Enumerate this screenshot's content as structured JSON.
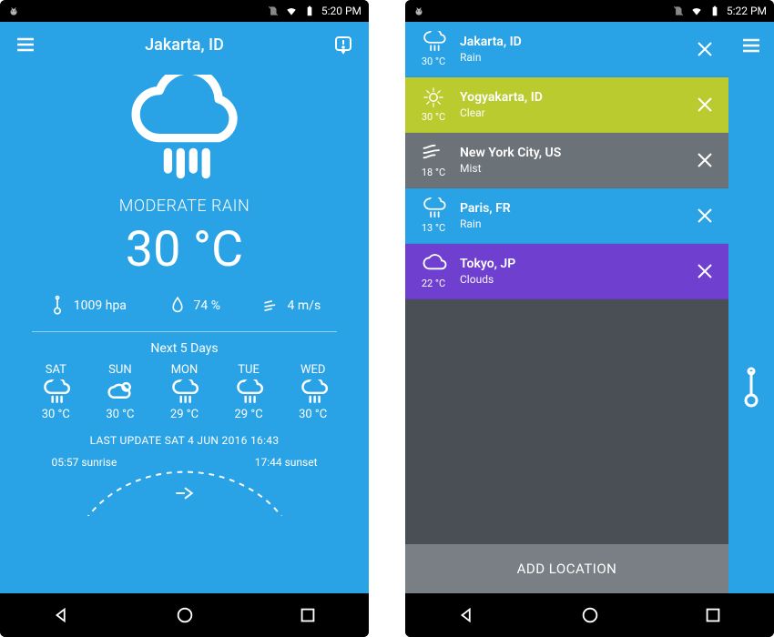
{
  "left": {
    "statusbar": {
      "time": "5:20 PM"
    },
    "header": {
      "title": "Jakarta, ID"
    },
    "main": {
      "condition": "MODERATE RAIN",
      "temp": "30 °C"
    },
    "stats": {
      "pressure": "1009 hpa",
      "humidity": "74 %",
      "wind": "4 m/s"
    },
    "next5_label": "Next 5 Days",
    "forecast": [
      {
        "day": "SAT",
        "temp": "30 °C",
        "icon": "cloud-rain"
      },
      {
        "day": "SUN",
        "temp": "30 °C",
        "icon": "cloud-sun"
      },
      {
        "day": "MON",
        "temp": "29 °C",
        "icon": "cloud-rain"
      },
      {
        "day": "TUE",
        "temp": "29 °C",
        "icon": "cloud-rain"
      },
      {
        "day": "WED",
        "temp": "30 °C",
        "icon": "cloud-rain"
      }
    ],
    "last_update": "LAST UPDATE SAT 4 JUN 2016 16:43",
    "sunrise": "05:57 sunrise",
    "sunset": "17:44 sunset"
  },
  "right": {
    "statusbar": {
      "time": "5:22 PM"
    },
    "locations": [
      {
        "name": "Jakarta, ID",
        "temp": "30 °C",
        "condition": "Rain",
        "icon": "cloud-rain",
        "bg": "#29a3e5"
      },
      {
        "name": "Yogyakarta, ID",
        "temp": "30 °C",
        "condition": "Clear",
        "icon": "sun",
        "bg": "#b9cb2f"
      },
      {
        "name": "New York City, US",
        "temp": "18 °C",
        "condition": "Mist",
        "icon": "mist",
        "bg": "#6b7278"
      },
      {
        "name": "Paris, FR",
        "temp": "13 °C",
        "condition": "Rain",
        "icon": "cloud-rain",
        "bg": "#29a3e5"
      },
      {
        "name": "Tokyo, JP",
        "temp": "22 °C",
        "condition": "Clouds",
        "icon": "cloud",
        "bg": "#6f3fcf"
      }
    ],
    "add_location": "ADD LOCATION"
  }
}
